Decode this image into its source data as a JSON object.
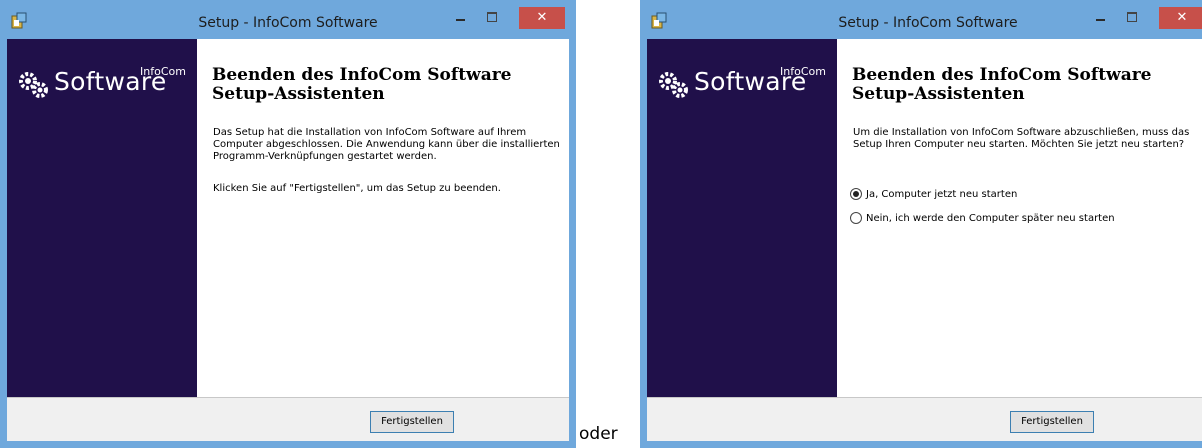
{
  "separator_text": "oder",
  "colors": {
    "window_border": "#6fa8dc",
    "sidebar": "#20104a",
    "close_button": "#c7504a",
    "button_border": "#3c7fb1"
  },
  "window1": {
    "title": "Setup - InfoCom Software",
    "close_glyph": "✕",
    "logo": {
      "main": "Software",
      "small": "InfoCom",
      "icon": "gears-icon"
    },
    "heading": "Beenden des InfoCom Software Setup-Assistenten",
    "para1": "Das Setup hat die Installation von InfoCom Software auf Ihrem Computer abgeschlossen. Die Anwendung kann über die installierten Programm-Verknüpfungen gestartet werden.",
    "para2": "Klicken Sie auf \"Fertigstellen\", um das Setup zu beenden.",
    "finish_label": "Fertigstellen"
  },
  "window2": {
    "title": "Setup - InfoCom Software",
    "close_glyph": "✕",
    "logo": {
      "main": "Software",
      "small": "InfoCom",
      "icon": "gears-icon"
    },
    "heading": "Beenden des InfoCom Software Setup-Assistenten",
    "para1": "Um die Installation von InfoCom Software abzuschließen, muss das Setup Ihren Computer neu starten. Möchten Sie jetzt neu starten?",
    "options": [
      {
        "label": "Ja, Computer jetzt neu starten",
        "checked": true
      },
      {
        "label": "Nein, ich werde den Computer später neu starten",
        "checked": false
      }
    ],
    "finish_label": "Fertigstellen"
  }
}
